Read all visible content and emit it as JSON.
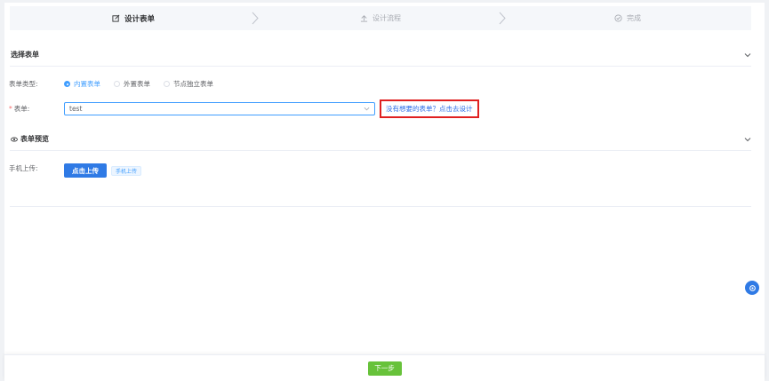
{
  "steps": [
    {
      "label": "设计表单",
      "icon": "edit-icon",
      "active": true
    },
    {
      "label": "设计流程",
      "icon": "upload-icon",
      "active": false
    },
    {
      "label": "完成",
      "icon": "check-circle-icon",
      "active": false
    }
  ],
  "section_select": {
    "title": "选择表单"
  },
  "form_type": {
    "label": "表单类型:",
    "options": [
      "内置表单",
      "外置表单",
      "节点独立表单"
    ],
    "selected": "内置表单"
  },
  "form_field": {
    "required_mark": "*",
    "label": "表单:",
    "value": "test",
    "design_link": "没有想要的表单？点击去设计"
  },
  "section_preview": {
    "title": "表单预览"
  },
  "mobile_upload": {
    "label": "手机上传:",
    "button": "点击上传",
    "tag": "手机上传"
  },
  "footer": {
    "next_button": "下一步"
  },
  "colors": {
    "primary": "#2f7ae5",
    "success": "#67c23a",
    "highlight": "#e02020"
  }
}
